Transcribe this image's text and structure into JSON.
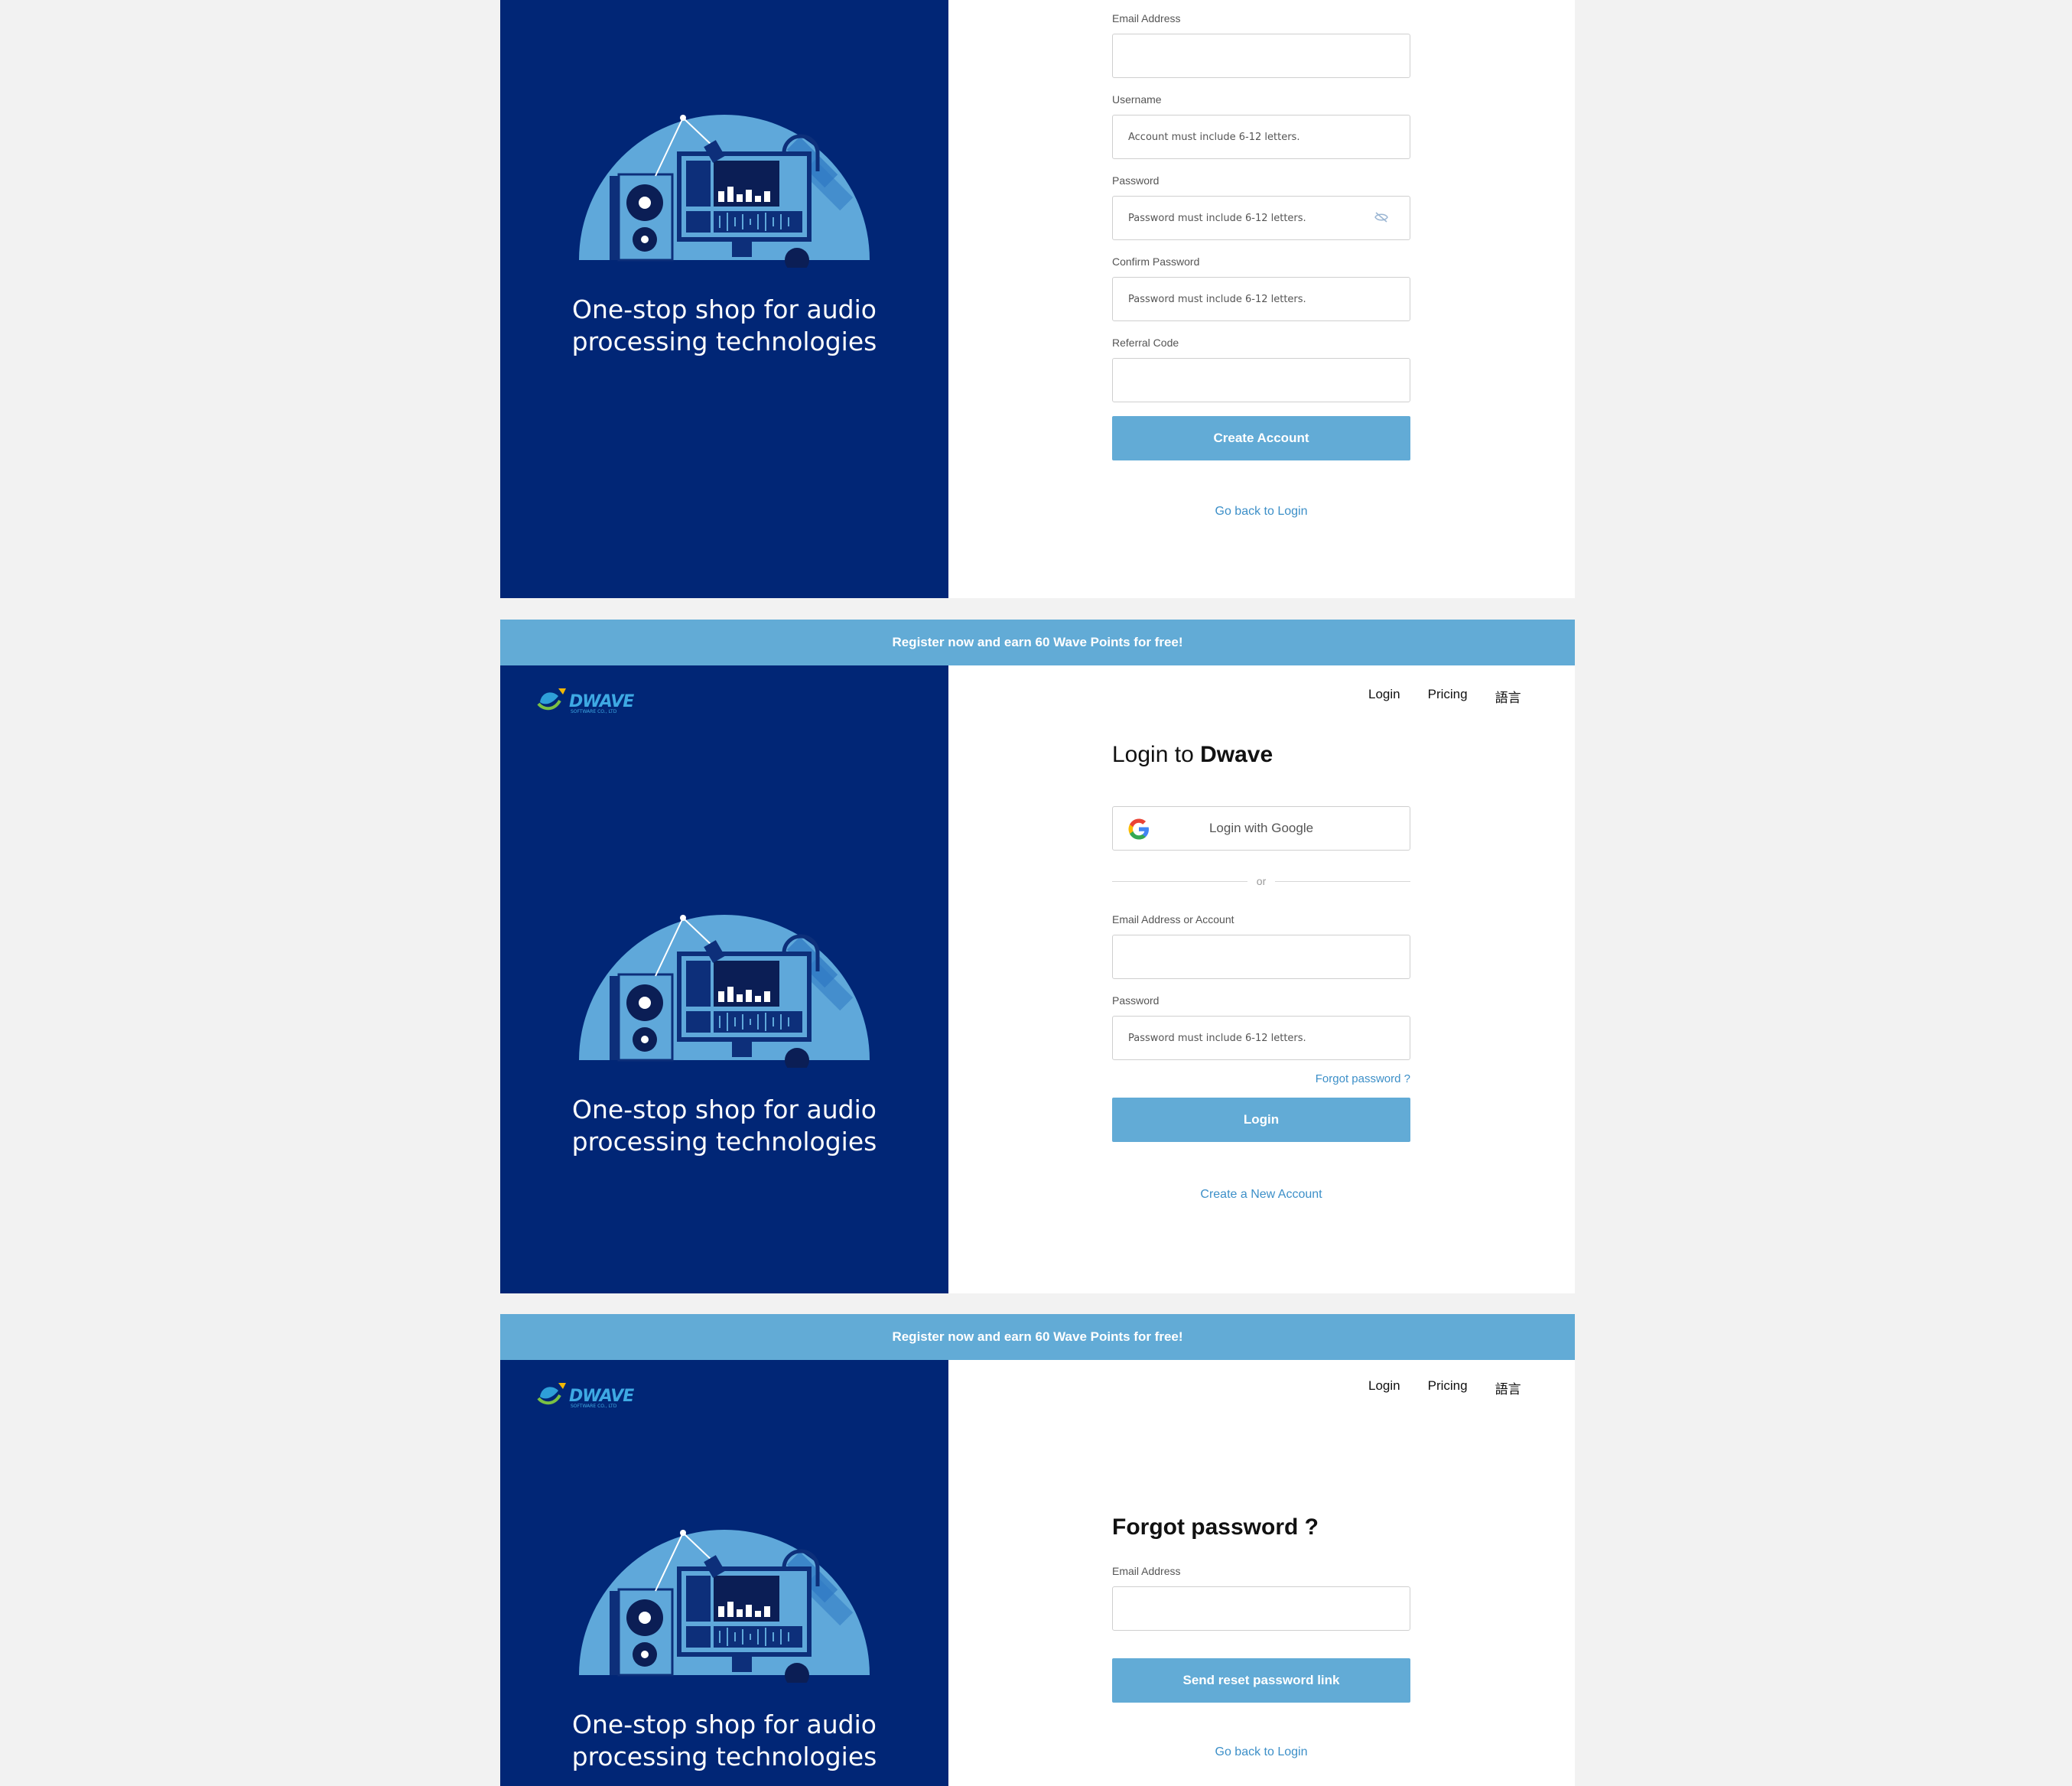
{
  "promo_banner": "Register now and earn 60 Wave Points for free!",
  "brand": {
    "logo_text": "DWAVE",
    "logo_subtext": "SOFTWARE CO., LTD"
  },
  "tagline": {
    "line1": "One-stop shop for audio",
    "line2": "processing technologies"
  },
  "nav": {
    "login": "Login",
    "pricing": "Pricing",
    "language": "語言"
  },
  "register": {
    "email_label": "Email Address",
    "email_value": "",
    "username_label": "Username",
    "username_placeholder": "Account must include 6-12 letters.",
    "password_label": "Password",
    "password_placeholder": "Password must include 6-12 letters.",
    "confirm_label": "Confirm Password",
    "confirm_placeholder": "Password must include 6-12 letters.",
    "referral_label": "Referral Code",
    "referral_value": "",
    "create_button": "Create Account",
    "back_link": "Go back to Login"
  },
  "login": {
    "title_prefix": "Login to ",
    "title_brand": "Dwave",
    "google_button": "Login with Google",
    "or": "or",
    "email_label": "Email Address or Account",
    "email_value": "",
    "password_label": "Password",
    "password_placeholder": "Password must include 6-12 letters.",
    "forgot_link": "Forgot password ?",
    "login_button": "Login",
    "create_link": "Create a New Account"
  },
  "forgot": {
    "title": "Forgot password ?",
    "email_label": "Email Address",
    "email_value": "",
    "send_button": "Send reset password link",
    "back_link": "Go back to Login"
  },
  "colors": {
    "accent": "#62abd6",
    "left_panel": "#012676",
    "link": "#3c8fc8",
    "illustration_dome": "#5fa8da"
  }
}
